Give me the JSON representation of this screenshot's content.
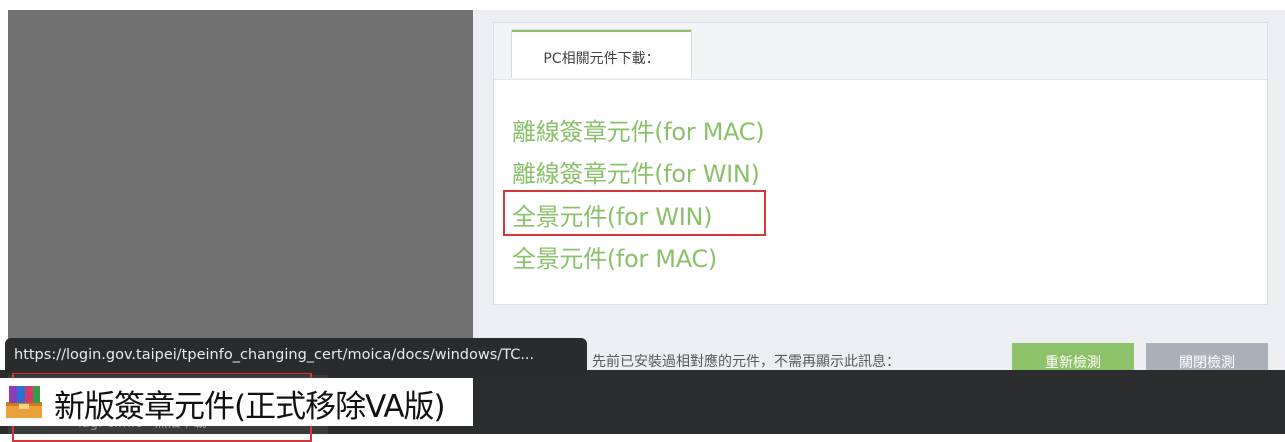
{
  "download_panel": {
    "tab_label": "PC相關元件下載：",
    "links": [
      "離線簽章元件(for MAC)",
      "離線簽章元件(for WIN)",
      "全景元件(for WIN)",
      "全景元件(for MAC)"
    ]
  },
  "footer": {
    "notice": "先前已安裝過相對應的元件，不需再顯示此訊息：",
    "recheck_button": "重新檢測",
    "close_button": "關閉檢測"
  },
  "status_bar": {
    "url": "https://login.gov.taipei/tpeinfo_changing_cert/moica/docs/windows/TC..."
  },
  "taskbar": {
    "item_label": "Tag.-c.m.c · 無法下載"
  },
  "download_file": {
    "name": "新版簽章元件(正式移除VA版)",
    "icon": "winrar-archive-icon"
  },
  "colors": {
    "accent_green": "#8dc26b",
    "link_green": "#8bc16b",
    "highlight_red": "#d9343a"
  }
}
